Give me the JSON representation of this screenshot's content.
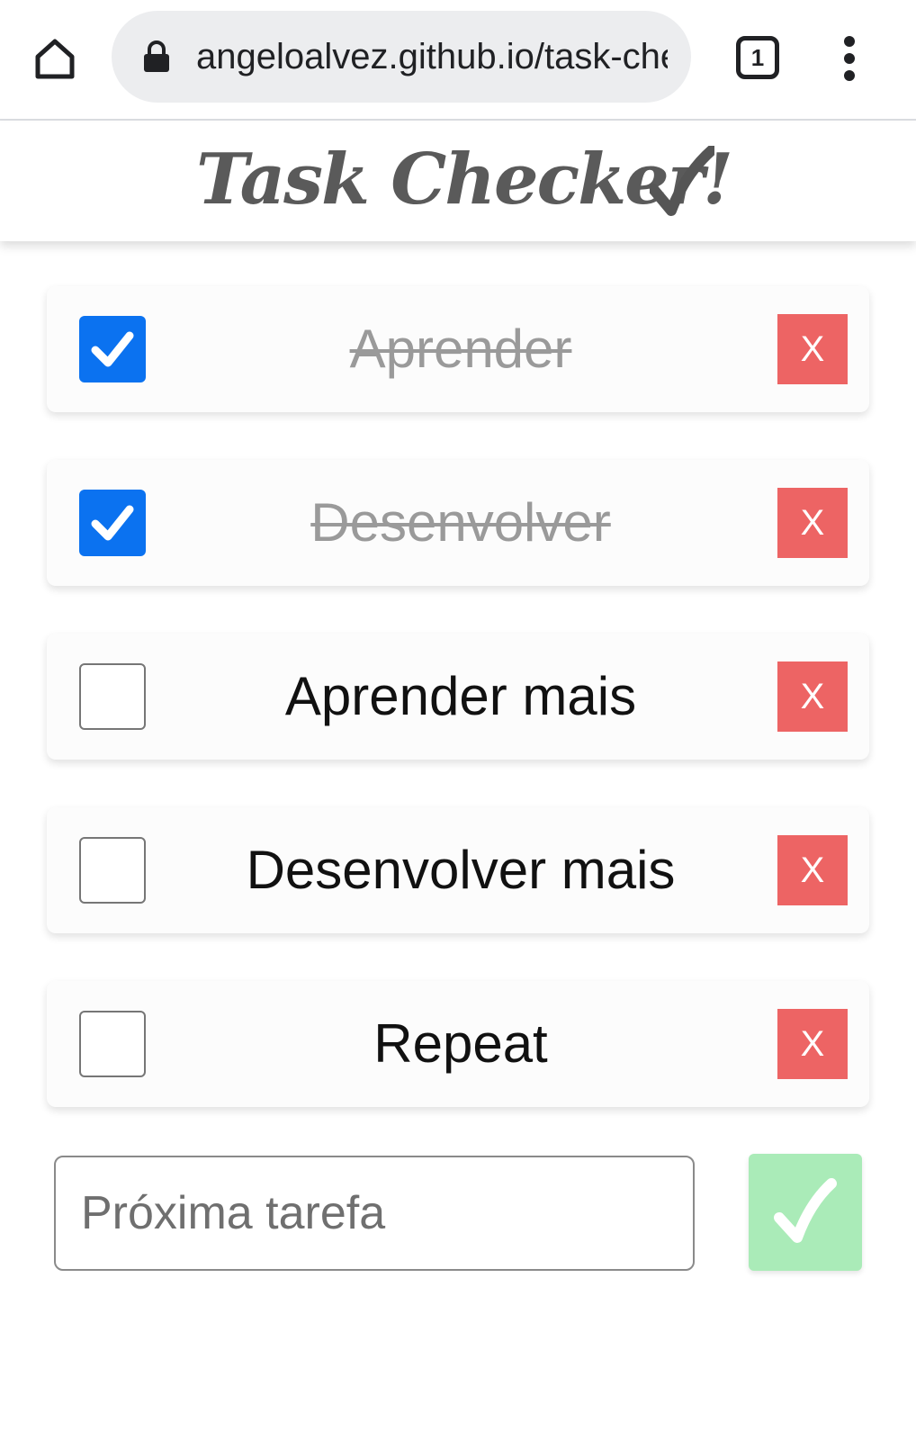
{
  "browser": {
    "url": "angeloalvez.github.io/task-checker",
    "tab_count": "1",
    "icons": {
      "home": "home-icon",
      "lock": "lock-icon",
      "tabs": "tabs-icon",
      "menu": "more-vert-icon"
    }
  },
  "app": {
    "title": "Task Checker!",
    "title_icon": "checkmark-icon"
  },
  "tasks": [
    {
      "label": "Aprender",
      "done": true,
      "delete_label": "X"
    },
    {
      "label": "Desenvolver",
      "done": true,
      "delete_label": "X"
    },
    {
      "label": "Aprender mais",
      "done": false,
      "delete_label": "X"
    },
    {
      "label": "Desenvolver mais",
      "done": false,
      "delete_label": "X"
    },
    {
      "label": "Repeat",
      "done": false,
      "delete_label": "X"
    }
  ],
  "new_task": {
    "placeholder": "Próxima tarefa",
    "value": "",
    "submit_icon": "checkmark-icon"
  },
  "colors": {
    "checkbox_checked": "#0b72f0",
    "delete_button": "#ed6464",
    "submit_button": "#aaebb8",
    "title_text": "#5a5a5a",
    "done_text": "#9a9a9a"
  }
}
